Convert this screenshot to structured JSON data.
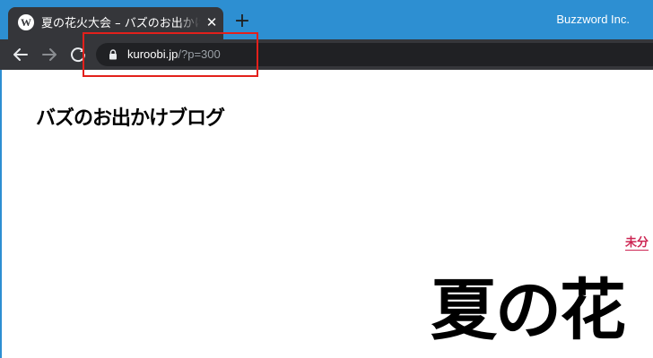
{
  "browser": {
    "tab": {
      "favicon": "W",
      "title": "夏の花火大会 – バズのお出かけブログ",
      "close_label": "✕"
    },
    "new_tab_label": "+",
    "window_title": "Buzzword Inc.",
    "toolbar": {
      "back_icon": "arrow-left-icon",
      "forward_icon": "arrow-right-icon",
      "reload_icon": "reload-icon"
    },
    "address_bar": {
      "lock_icon": "lock-icon",
      "host": "kuroobi.jp",
      "path": "/?p=300"
    },
    "highlight_color": "#e3201b",
    "accent_color": "#2d8fd2"
  },
  "page": {
    "site_title": "バズのお出かけブログ",
    "category_link": "未分",
    "post_title": "夏の花",
    "category_color": "#cd2653"
  }
}
